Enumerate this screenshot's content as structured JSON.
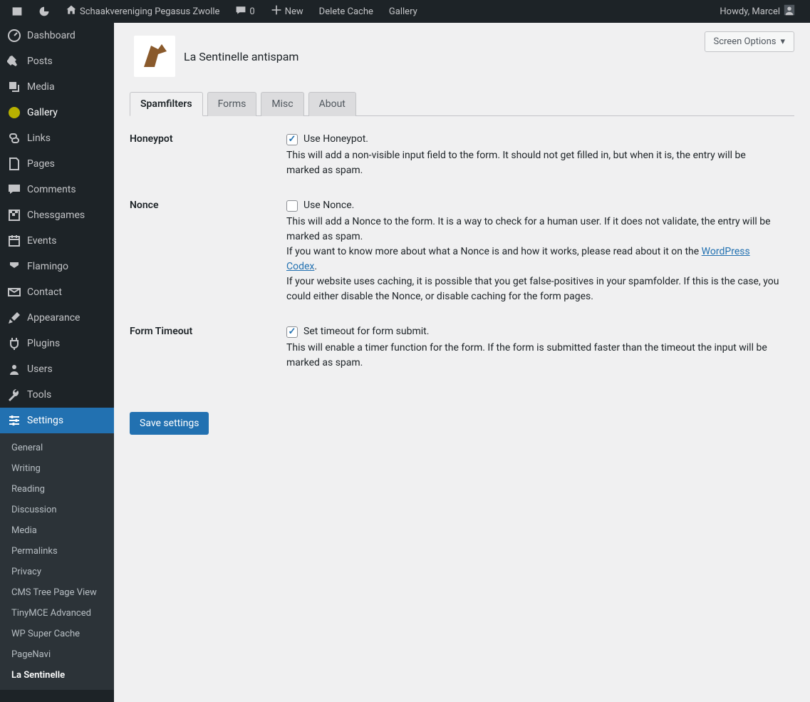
{
  "adminbar": {
    "site_name": "Schaakvereniging Pegasus Zwolle",
    "comments_count": "0",
    "new_label": "New",
    "delete_cache": "Delete Cache",
    "gallery": "Gallery",
    "howdy": "Howdy, Marcel"
  },
  "sidebar": {
    "items": [
      {
        "label": "Dashboard"
      },
      {
        "label": "Posts"
      },
      {
        "label": "Media"
      },
      {
        "label": "Gallery"
      },
      {
        "label": "Links"
      },
      {
        "label": "Pages"
      },
      {
        "label": "Comments"
      },
      {
        "label": "Chessgames"
      },
      {
        "label": "Events"
      },
      {
        "label": "Flamingo"
      },
      {
        "label": "Contact"
      },
      {
        "label": "Appearance"
      },
      {
        "label": "Plugins"
      },
      {
        "label": "Users"
      },
      {
        "label": "Tools"
      },
      {
        "label": "Settings"
      }
    ],
    "submenu": [
      {
        "label": "General"
      },
      {
        "label": "Writing"
      },
      {
        "label": "Reading"
      },
      {
        "label": "Discussion"
      },
      {
        "label": "Media"
      },
      {
        "label": "Permalinks"
      },
      {
        "label": "Privacy"
      },
      {
        "label": "CMS Tree Page View"
      },
      {
        "label": "TinyMCE Advanced"
      },
      {
        "label": "WP Super Cache"
      },
      {
        "label": "PageNavi"
      },
      {
        "label": "La Sentinelle"
      }
    ]
  },
  "screen_options": {
    "label": "Screen Options"
  },
  "page": {
    "title": "La Sentinelle antispam"
  },
  "tabs": {
    "items": [
      {
        "label": "Spamfilters"
      },
      {
        "label": "Forms"
      },
      {
        "label": "Misc"
      },
      {
        "label": "About"
      }
    ]
  },
  "options": {
    "honeypot": {
      "label": "Honeypot",
      "checkbox_label": "Use Honeypot.",
      "description": "This will add a non-visible input field to the form. It should not get filled in, but when it is, the entry will be marked as spam."
    },
    "nonce": {
      "label": "Nonce",
      "checkbox_label": "Use Nonce.",
      "desc1": "This will add a Nonce to the form. It is a way to check for a human user. If it does not validate, the entry will be marked as spam.",
      "desc2_pre": "If you want to know more about what a Nonce is and how it works, please read about it on the ",
      "desc2_link": "WordPress Codex",
      "desc2_post": ".",
      "desc3": "If your website uses caching, it is possible that you get false-positives in your spamfolder. If this is the case, you could either disable the Nonce, or disable caching for the form pages."
    },
    "timeout": {
      "label": "Form Timeout",
      "checkbox_label": "Set timeout for form submit.",
      "description": "This will enable a timer function for the form. If the form is submitted faster than the timeout the input will be marked as spam."
    }
  },
  "save_button": "Save settings"
}
